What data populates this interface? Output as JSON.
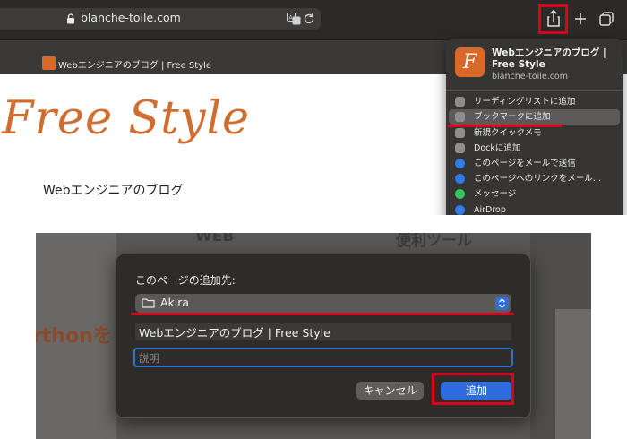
{
  "browser": {
    "url": "blanche-toile.com",
    "tab_title": "Webエンジニアのブログ | Free Style"
  },
  "webpage": {
    "hero": "Free Style",
    "subtitle": "Webエンジニアのブログ"
  },
  "share_menu": {
    "icon_letter": "F",
    "title": "Webエンジニアのブログ | Free Style",
    "url": "blanche-toile.com",
    "items": [
      {
        "label": "リーディングリストに追加",
        "icon": "reading-list-icon",
        "color": "#8e8e8e"
      },
      {
        "label": "ブックマークに追加",
        "icon": "book-icon",
        "color": "#8e8e8e",
        "highlighted": true
      },
      {
        "label": "新規クイックメモ",
        "icon": "quick-note-icon",
        "color": "#8e8e8e"
      },
      {
        "label": "Dockに追加",
        "icon": "dock-icon",
        "color": "#8e8e8e"
      },
      {
        "label": "このページをメールで送信",
        "icon": "mail-icon",
        "color": "#2f7be6"
      },
      {
        "label": "このページへのリンクをメール…",
        "icon": "mail-link-icon",
        "color": "#2f7be6"
      },
      {
        "label": "メッセージ",
        "icon": "messages-icon",
        "color": "#34c759"
      },
      {
        "label": "AirDrop",
        "icon": "airdrop-icon",
        "color": "#2f7be6"
      }
    ]
  },
  "background_page": {
    "nav_web": "WEB",
    "nav_tools": "便利ツール",
    "heading_fragment": "rthonを"
  },
  "dialog": {
    "label": "このページの追加先:",
    "folder": "Akira",
    "name_value": "Webエンジニアのブログ | Free Style",
    "description_placeholder": "説明",
    "cancel_label": "キャンセル",
    "add_label": "追加"
  },
  "colors": {
    "highlight_red": "#e0001a",
    "accent_blue": "#2e6bdd",
    "brand_orange": "#d16d2e"
  }
}
